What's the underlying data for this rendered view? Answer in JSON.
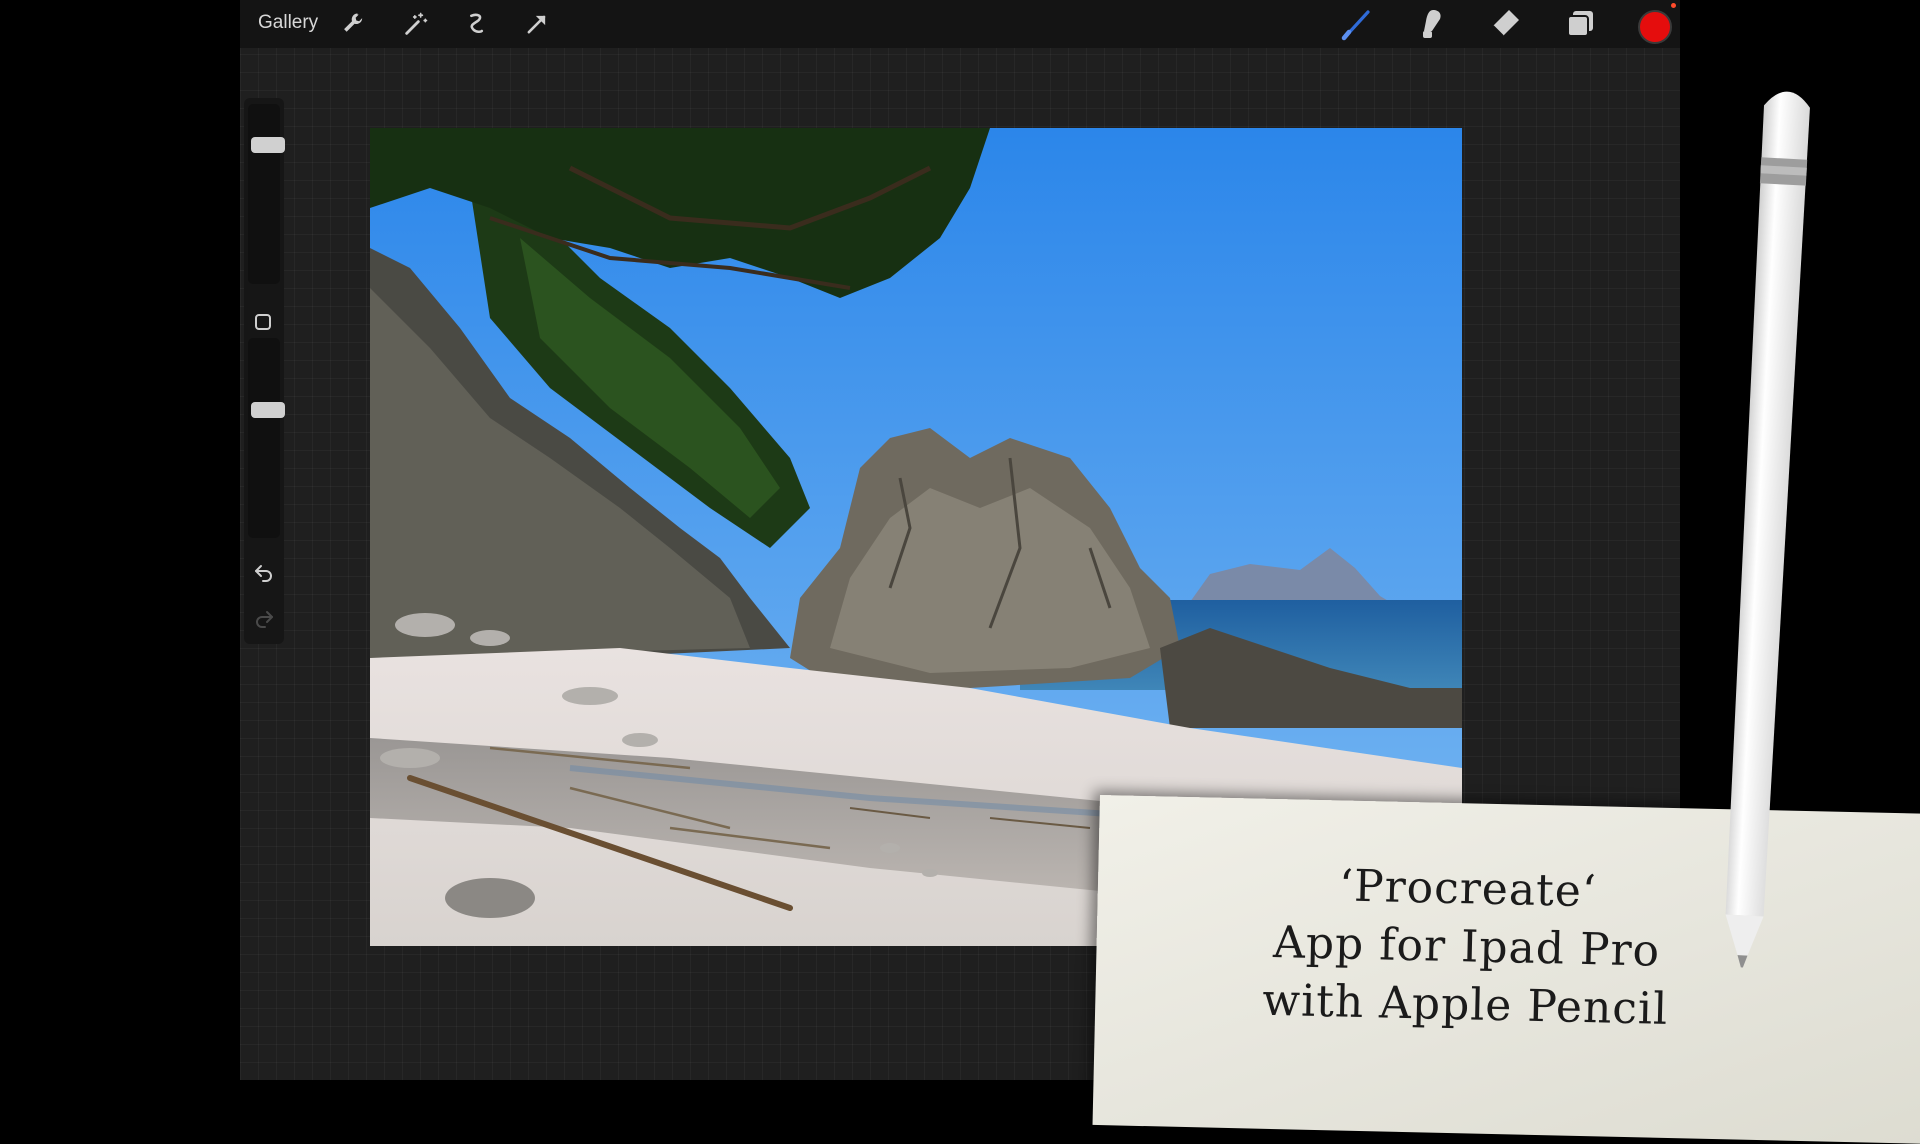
{
  "topbar": {
    "gallery_label": "Gallery",
    "left_tools": [
      "wrench-icon",
      "magic-wand-icon",
      "selection-icon",
      "transform-arrow-icon"
    ],
    "right_tools": [
      "brush-icon",
      "smudge-icon",
      "eraser-icon",
      "layers-icon"
    ],
    "current_color": "#e50d0d"
  },
  "sidebar": {
    "brush_size_level": 0.2,
    "opacity_level": 0.35
  },
  "note": {
    "line1": "‘Procreate‘",
    "line2": "App for Ipad Pro",
    "line3": "with Apple Pencil"
  }
}
